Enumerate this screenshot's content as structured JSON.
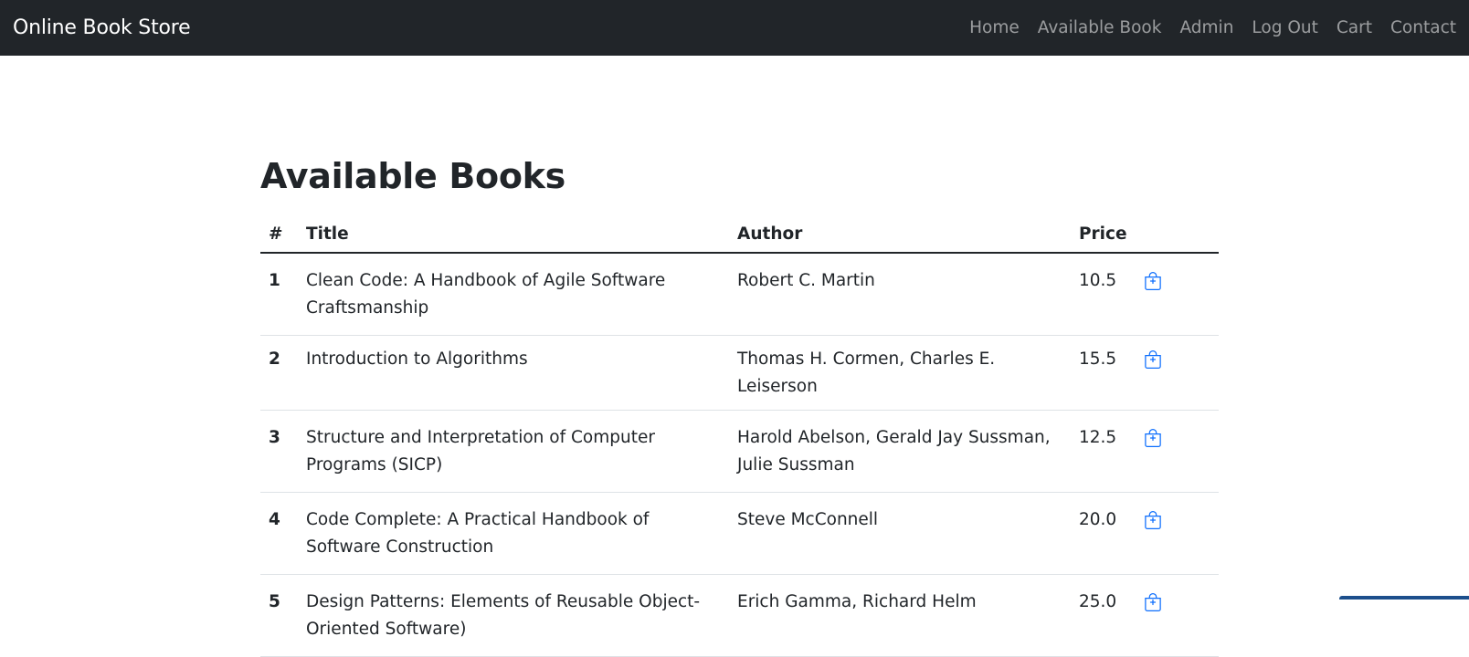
{
  "navbar": {
    "brand": "Online Book Store",
    "links": [
      "Home",
      "Available Book",
      "Admin",
      "Log Out",
      "Cart",
      "Contact"
    ]
  },
  "main": {
    "title": "Available Books",
    "columns": [
      "#",
      "Title",
      "Author",
      "Price"
    ],
    "rows": [
      {
        "num": "1",
        "title": "Clean Code: A Handbook of Agile Software Craftsmanship",
        "author": "Robert C. Martin",
        "price": "10.5",
        "icon": "cart-add-icon"
      },
      {
        "num": "2",
        "title": "Introduction to Algorithms",
        "author": "Thomas H. Cormen, Charles E. Leiserson",
        "price": "15.5",
        "icon": "cart-add-icon"
      },
      {
        "num": "3",
        "title": "Structure and Interpretation of Computer Programs (SICP)",
        "author": "Harold Abelson, Gerald Jay Sussman, Julie Sussman",
        "price": "12.5",
        "icon": "cart-add-icon"
      },
      {
        "num": "4",
        "title": "Code Complete: A Practical Handbook of Software Construction",
        "author": "Steve McConnell",
        "price": "20.0",
        "icon": "cart-add-icon"
      },
      {
        "num": "5",
        "title": "Design Patterns: Elements of Reusable Object-Oriented Software)",
        "author": "Erich Gamma, Richard Helm",
        "price": "25.0",
        "icon": "cart-add-icon"
      }
    ]
  },
  "colors": {
    "navbar_bg": "#212529",
    "accent": "#0d6efd"
  }
}
